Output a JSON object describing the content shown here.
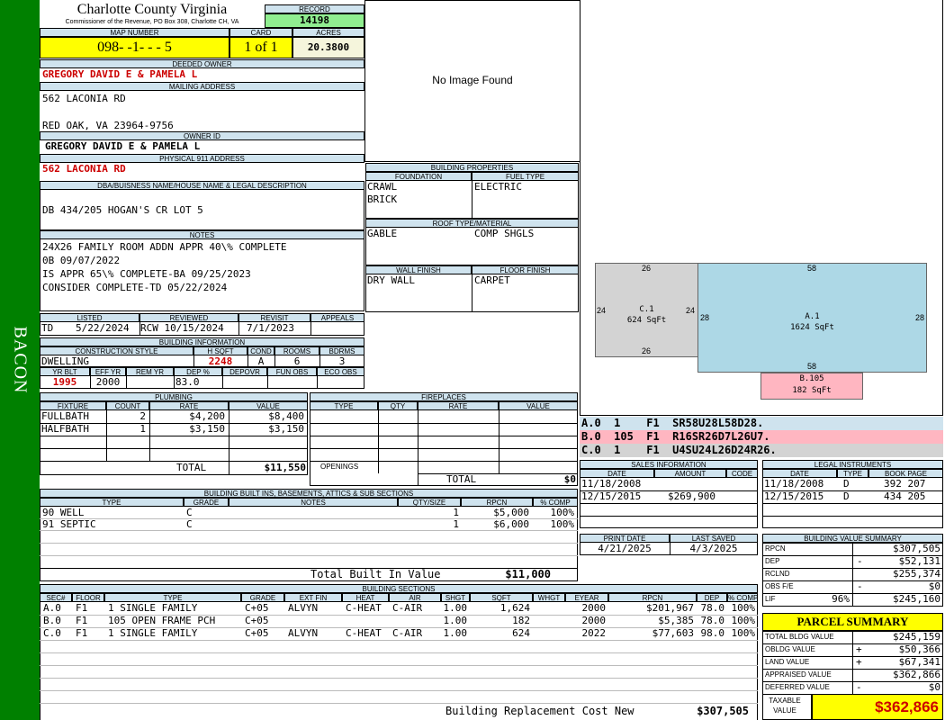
{
  "side_label": "BACON",
  "header": {
    "county": "Charlotte County Virginia",
    "commissioner": "Commissioner of the Revenue, PO Box 308, Charlotte CH, VA",
    "record_label": "RECORD",
    "record": "14198"
  },
  "map": {
    "map_label": "MAP NUMBER",
    "map_number": "098- -1- - - 5",
    "card_label": "CARD",
    "card": "1 of 1",
    "acres_label": "ACRES",
    "acres": "20.3800"
  },
  "owner": {
    "deeded_label": "DEEDED OWNER",
    "deeded": "GREGORY DAVID E & PAMELA L",
    "mailing_label": "MAILING ADDRESS",
    "mail1": "562 LACONIA RD",
    "mail2": "RED OAK, VA 23964-9756",
    "ownerid_label": "OWNER ID",
    "ownerid": "GREGORY DAVID E & PAMELA L",
    "phys_label": "PHYSICAL 911 ADDRESS",
    "phys": "562 LACONIA RD"
  },
  "dba": {
    "label": "DBA/BUISNESS NAME/HOUSE NAME & LEGAL DESCRIPTION",
    "text": "DB 434/205 HOGAN'S CR LOT 5"
  },
  "notes": {
    "label": "NOTES",
    "lines": [
      "24X26 FAMILY ROOM ADDN APPR 40\\% COMPLETE",
      "0B 09/07/2022",
      "IS APPR 65\\% COMPLETE-BA 09/25/2023",
      "CONSIDER COMPLETE-TD 05/22/2024"
    ]
  },
  "listing": {
    "listed_label": "LISTED",
    "listed_by": "TD",
    "listed": "5/22/2024",
    "reviewed_label": "REVIEWED",
    "reviewed": "RCW 10/15/2024",
    "revisit_label": "REVISIT",
    "revisit": "7/1/2023",
    "appeals_label": "APPEALS"
  },
  "building_info": {
    "label": "BUILDING INFORMATION",
    "style_label": "CONSTRUCTION STYLE",
    "style": "DWELLING",
    "hsqft_label": "H SQFT",
    "hsqft": "2248",
    "cond_label": "COND",
    "cond": "A",
    "rooms_label": "ROOMS",
    "rooms": "6",
    "bdrms_label": "BDRMS",
    "bdrms": "3",
    "yrblt_label": "YR BLT",
    "yrblt": "1995",
    "effyr_label": "EFF YR",
    "effyr": "2000",
    "remyr_label": "REM YR",
    "dep_label": "DEP %",
    "dep": "83.0",
    "depovr_label": "DEPOVR",
    "funobs_label": "FUN OBS",
    "ecoobs_label": "ECO OBS"
  },
  "plumbing": {
    "label": "PLUMBING",
    "cols": [
      "FIXTURE",
      "COUNT",
      "RATE",
      "VALUE"
    ],
    "rows": [
      [
        "FULLBATH",
        "2",
        "$4,200",
        "$8,400"
      ],
      [
        "HALFBATH",
        "1",
        "$3,150",
        "$3,150"
      ]
    ],
    "total_label": "TOTAL",
    "total": "$11,550"
  },
  "fireplaces": {
    "label": "FIREPLACES",
    "cols": [
      "TYPE",
      "QTY",
      "RATE",
      "VALUE"
    ],
    "openings_label": "OPENINGS",
    "total_label": "TOTAL",
    "total": "$0"
  },
  "no_image": "No Image Found",
  "building_props": {
    "label": "BUILDING PROPERTIES",
    "foundation_label": "FOUNDATION",
    "foundation": [
      "CRAWL",
      "BRICK"
    ],
    "fuel_label": "FUEL TYPE",
    "fuel": "ELECTRIC",
    "roof_label": "ROOF TYPE/MATERIAL",
    "roof_type": "GABLE",
    "roof_mat": "COMP SHGLS",
    "wall_label": "WALL FINISH",
    "wall": "DRY WALL",
    "floor_label": "FLOOR FINISH",
    "floor": "CARPET"
  },
  "sketch": {
    "c1": {
      "label": "C.1",
      "area": "624 SqFt",
      "top": "26",
      "bottom": "26",
      "left": "24",
      "right": "24"
    },
    "a1": {
      "label": "A.1",
      "area": "1624 SqFt",
      "top": "58",
      "bottom": "58",
      "left": "28",
      "right": "28"
    },
    "b105": {
      "label": "B.105",
      "area": "182 SqFt"
    },
    "colors": {
      "c1": "#d3d3d3",
      "a1": "#add8e6",
      "b105": "#ffb6c1"
    }
  },
  "vectors": [
    "A.0  1    F1  SR58U28L58D28.",
    "B.0  105  F1  R16SR26D7L26U7.",
    "C.0  1    F1  U4SU24L26D24R26."
  ],
  "sales": {
    "label": "SALES INFORMATION",
    "cols": [
      "DATE",
      "AMOUNT",
      "CODE"
    ],
    "rows": [
      [
        "11/18/2008",
        "",
        ""
      ],
      [
        "12/15/2015",
        "$269,900",
        ""
      ]
    ]
  },
  "legal": {
    "label": "LEGAL INSTRUMENTS",
    "cols": [
      "DATE",
      "TYPE",
      "BOOK PAGE"
    ],
    "rows": [
      [
        "11/18/2008",
        "D",
        "392 207"
      ],
      [
        "12/15/2015",
        "D",
        "434 205"
      ]
    ]
  },
  "print": {
    "print_label": "PRINT DATE",
    "print": "4/21/2025",
    "saved_label": "LAST SAVED",
    "saved": "4/3/2025"
  },
  "builtins": {
    "label": "BUILDING BUILT INS, BASEMENTS, ATTICS & SUB SECTIONS",
    "cols": [
      "TYPE",
      "GRADE",
      "NOTES",
      "QTY/SIZE",
      "RPCN",
      "% COMP"
    ],
    "rows": [
      [
        "90 WELL",
        "C",
        "",
        "1",
        "$5,000",
        "100%"
      ],
      [
        "91 SEPTIC",
        "C",
        "",
        "1",
        "$6,000",
        "100%"
      ]
    ],
    "total_label": "Total Built In Value",
    "total": "$11,000"
  },
  "sections": {
    "label": "BUILDING SECTIONS",
    "cols": [
      "SEC#",
      "FLOOR",
      "TYPE",
      "GRADE",
      "EXT FIN",
      "HEAT",
      "AIR",
      "SHGT",
      "SQFT",
      "WHGT",
      "EYEAR",
      "RPCN",
      "DEP",
      "% COMP"
    ],
    "rows": [
      [
        "A.0",
        "F1",
        "1 SINGLE FAMILY",
        "C+05",
        "ALVYN",
        "C-HEAT",
        "C-AIR",
        "1.00",
        "1,624",
        "",
        "2000",
        "$201,967",
        "78.0",
        "100%"
      ],
      [
        "B.0",
        "F1",
        "105 OPEN FRAME PCH",
        "C+05",
        "",
        "",
        "",
        "1.00",
        "182",
        "",
        "2000",
        "$5,385",
        "78.0",
        "100%"
      ],
      [
        "C.0",
        "F1",
        "1 SINGLE FAMILY",
        "C+05",
        "ALVYN",
        "C-HEAT",
        "C-AIR",
        "1.00",
        "624",
        "",
        "2022",
        "$77,603",
        "98.0",
        "100%"
      ]
    ],
    "total_label": "Building Replacement Cost New",
    "total": "$307,505"
  },
  "value_summary": {
    "label": "BUILDING VALUE SUMMARY",
    "rows": [
      [
        "RPCN",
        "",
        "$307,505"
      ],
      [
        "DEP",
        "-",
        "$52,131"
      ],
      [
        "RCLND",
        "",
        "$255,374"
      ],
      [
        "OBS F/E",
        "-",
        "$0"
      ],
      [
        "LIF",
        "96%",
        "$245,160"
      ]
    ]
  },
  "parcel": {
    "label": "PARCEL SUMMARY",
    "rows": [
      [
        "TOTAL BLDG VALUE",
        "",
        "$245,159"
      ],
      [
        "OBLDG VALUE",
        "+",
        "$50,366"
      ],
      [
        "LAND VALUE",
        "+",
        "$67,341"
      ],
      [
        "APPRAISED VALUE",
        "",
        "$362,866"
      ],
      [
        "DEFERRED VALUE",
        "-",
        "$0"
      ]
    ],
    "taxable_label": "TAXABLE VALUE",
    "taxable": "$362,866"
  },
  "colors": {
    "side": "#008000",
    "yellow": "#ffff00",
    "green": "#90ee90",
    "header": "#cfe3ee",
    "red": "#cc0000"
  }
}
